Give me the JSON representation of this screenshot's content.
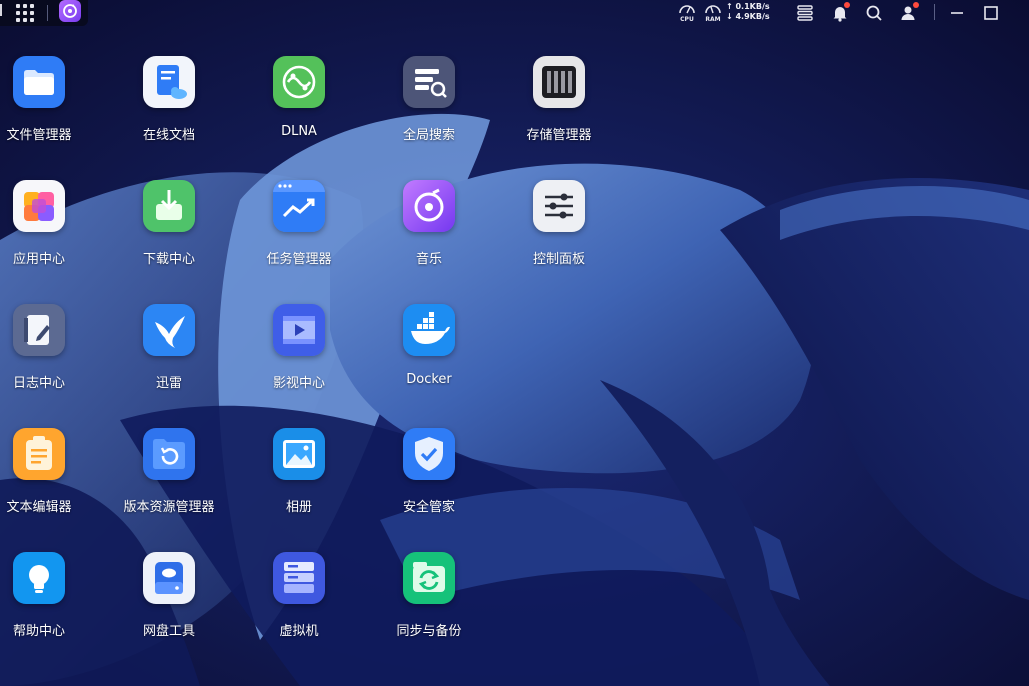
{
  "topbar": {
    "cpu_label": "CPU",
    "ram_label": "RAM",
    "upload": "↑ 0.1KB/s",
    "download": "↓ 4.9KB/s"
  },
  "apps": [
    {
      "label": "文件管理器"
    },
    {
      "label": "在线文档"
    },
    {
      "label": "DLNA"
    },
    {
      "label": "全局搜索"
    },
    {
      "label": "存储管理器"
    },
    {
      "label": "应用中心"
    },
    {
      "label": "下载中心"
    },
    {
      "label": "任务管理器"
    },
    {
      "label": "音乐"
    },
    {
      "label": "控制面板"
    },
    {
      "label": "日志中心"
    },
    {
      "label": "迅雷"
    },
    {
      "label": "影视中心"
    },
    {
      "label": "Docker"
    },
    {
      "label": "文本编辑器"
    },
    {
      "label": "版本资源管理器"
    },
    {
      "label": "相册"
    },
    {
      "label": "安全管家"
    },
    {
      "label": "帮助中心"
    },
    {
      "label": "网盘工具"
    },
    {
      "label": "虚拟机"
    },
    {
      "label": "同步与备份"
    }
  ],
  "colors": {
    "background": "#0d0f3a",
    "notification_dot": "#ff4a3d",
    "accent": "#7a3cf0"
  }
}
